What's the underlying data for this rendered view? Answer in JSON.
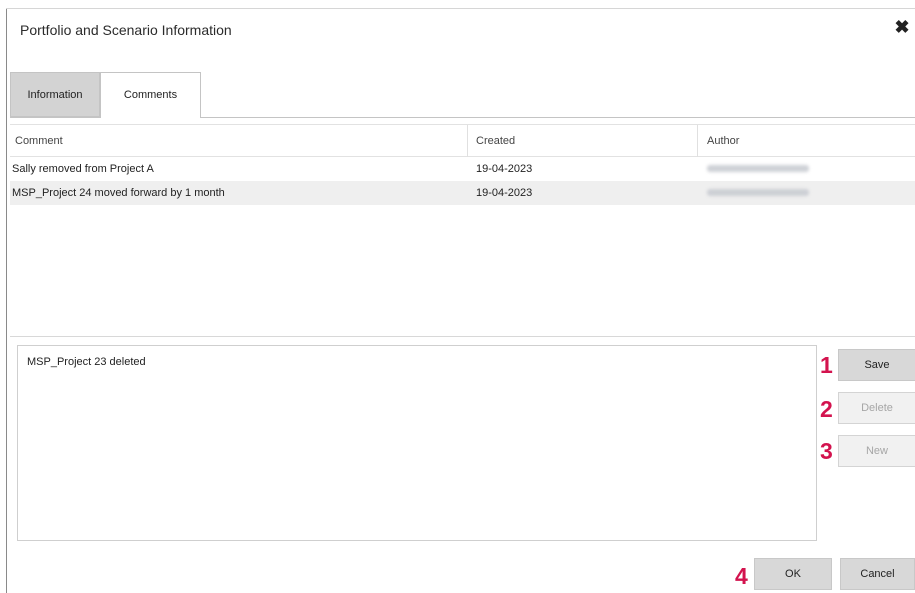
{
  "dialog": {
    "title": "Portfolio and Scenario Information",
    "close_icon": "close-icon"
  },
  "tabs": [
    {
      "label": "Information",
      "active": false
    },
    {
      "label": "Comments",
      "active": true
    }
  ],
  "grid": {
    "columns": [
      "Comment",
      "Created",
      "Author"
    ],
    "rows": [
      {
        "comment": "Sally removed from Project A",
        "created": "19-04-2023",
        "author_blurred": true
      },
      {
        "comment": "MSP_Project 24 moved forward by 1 month",
        "created": "19-04-2023",
        "author_blurred": true
      }
    ]
  },
  "editor": {
    "value": "MSP_Project 23 deleted"
  },
  "actions": {
    "save_label": "Save",
    "delete_label": "Delete",
    "new_label": "New",
    "ok_label": "OK",
    "cancel_label": "Cancel"
  },
  "markers": [
    "1",
    "2",
    "3",
    "4"
  ],
  "colors": {
    "marker": "#d3134e",
    "active_button": "#d8d8d8",
    "disabled_text": "#a6a6a6"
  }
}
